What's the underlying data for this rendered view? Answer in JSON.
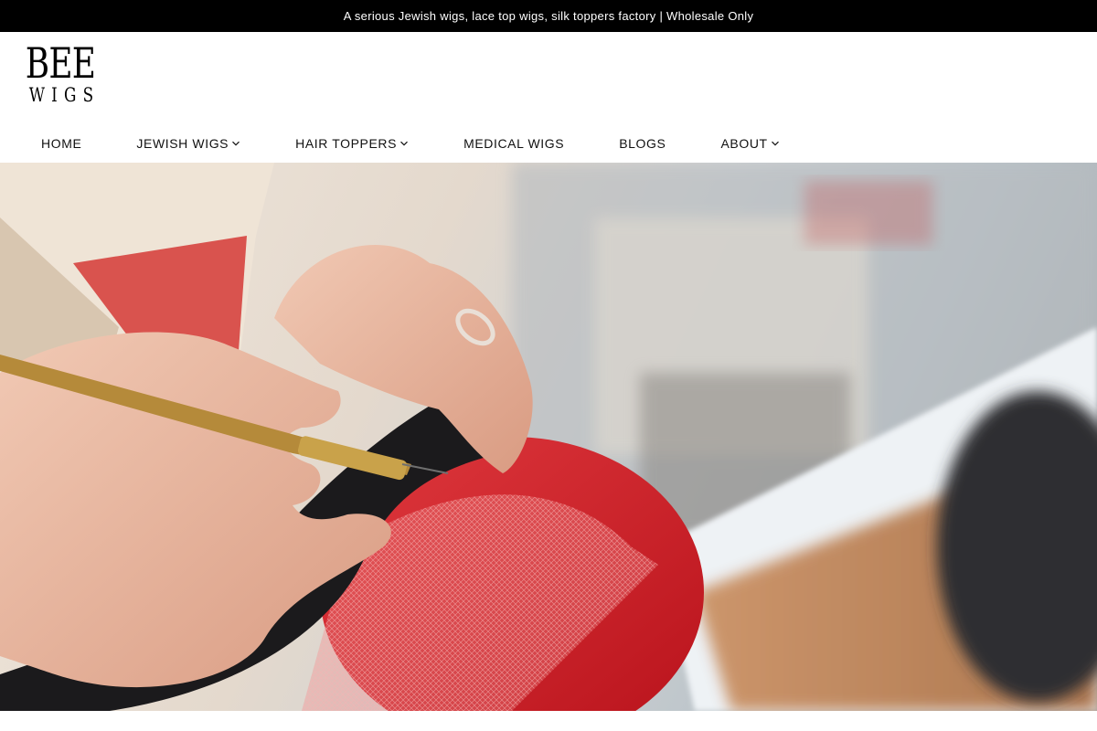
{
  "announcement": {
    "text": "A serious Jewish wigs, lace top wigs, silk toppers factory | Wholesale Only"
  },
  "logo": {
    "line1": "BEE",
    "line2": "WIGS"
  },
  "nav": {
    "items": [
      {
        "label": "HOME",
        "has_dropdown": false
      },
      {
        "label": "JEWISH WIGS",
        "has_dropdown": true
      },
      {
        "label": "HAIR TOPPERS",
        "has_dropdown": true
      },
      {
        "label": "MEDICAL WIGS",
        "has_dropdown": false
      },
      {
        "label": "BLOGS",
        "has_dropdown": false
      },
      {
        "label": "ABOUT",
        "has_dropdown": true
      }
    ]
  },
  "hero": {
    "image_subject": "hands ventilating hair into red lace on a wig block with a needle"
  },
  "colors": {
    "announcement_bg": "#000000",
    "header_bg": "#ffffff",
    "text": "#111111"
  }
}
